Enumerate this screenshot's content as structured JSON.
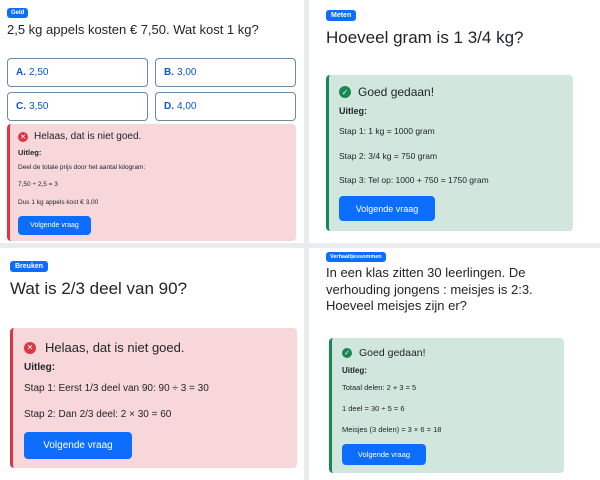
{
  "p1": {
    "badge": "Geld",
    "question": "2,5 kg appels kosten € 7,50. Wat kost 1 kg?",
    "options": [
      {
        "letter": "A.",
        "value": "2,50"
      },
      {
        "letter": "B.",
        "value": "3,00"
      },
      {
        "letter": "C.",
        "value": "3,50"
      },
      {
        "letter": "D.",
        "value": "4,00"
      }
    ],
    "feedback": {
      "status": "incorrect",
      "icon": "x-circle-icon",
      "title": "Helaas, dat is niet goed.",
      "explanation_label": "Uitleg:",
      "lines": [
        "Deel de totale prijs door het aantal kilogram:",
        "7,50 ÷ 2,5 = 3",
        "Dus 1 kg appels kost € 3,00"
      ],
      "button": "Volgende vraag"
    }
  },
  "p2": {
    "badge": "Meten",
    "question": "Hoeveel gram is 1 3/4 kg?",
    "feedback": {
      "status": "correct",
      "icon": "check-circle-icon",
      "title": "Goed gedaan!",
      "explanation_label": "Uitleg:",
      "lines": [
        "Stap 1: 1 kg = 1000 gram",
        "Stap 2: 3/4 kg = 750 gram",
        "Stap 3: Tel op: 1000 + 750 = 1750 gram"
      ],
      "button": "Volgende vraag"
    }
  },
  "p3": {
    "badge": "Breuken",
    "question": "Wat is 2/3 deel van 90?",
    "feedback": {
      "status": "incorrect",
      "icon": "x-circle-icon",
      "title": "Helaas, dat is niet goed.",
      "explanation_label": "Uitleg:",
      "lines": [
        "Stap 1: Eerst 1/3 deel van 90: 90 ÷ 3 = 30",
        "Stap 2: Dan 2/3 deel: 2 × 30 = 60"
      ],
      "button": "Volgende vraag"
    }
  },
  "p4": {
    "badge": "Verhaaltjessommen",
    "question_lines": [
      "In een klas zitten 30 leerlingen. De",
      "verhouding jongens : meisjes is 2:3.",
      "Hoeveel meisjes zijn er?"
    ],
    "feedback": {
      "status": "correct",
      "icon": "check-circle-icon",
      "title": "Goed gedaan!",
      "explanation_label": "Uitleg:",
      "lines": [
        "Totaal delen: 2 + 3 = 5",
        "1 deel = 30 ÷ 5 = 6",
        "Meisjes (3 delen) = 3 × 6 = 18"
      ],
      "button": "Volgende vraag"
    }
  },
  "colors": {
    "primary": "#0d6efd",
    "danger": "#dc3545",
    "danger_bg": "#f8d7da",
    "success": "#198754",
    "success_bg": "#d1e7dd"
  }
}
